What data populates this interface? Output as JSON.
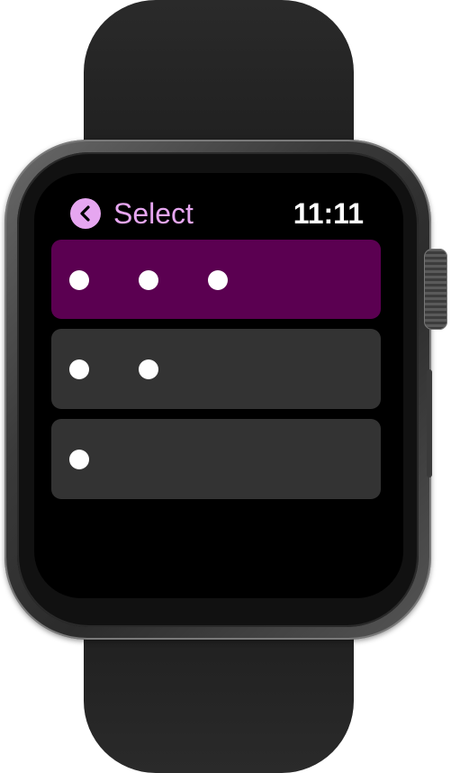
{
  "header": {
    "title": "Select",
    "time": "11:11"
  },
  "icons": {
    "back": "chevron-left-icon"
  },
  "colors": {
    "accent": "#e6a6f0",
    "selected_row": "#5b0051",
    "row": "#333333"
  },
  "options": [
    {
      "dots": 3,
      "selected": true
    },
    {
      "dots": 2,
      "selected": false
    },
    {
      "dots": 1,
      "selected": false
    }
  ]
}
